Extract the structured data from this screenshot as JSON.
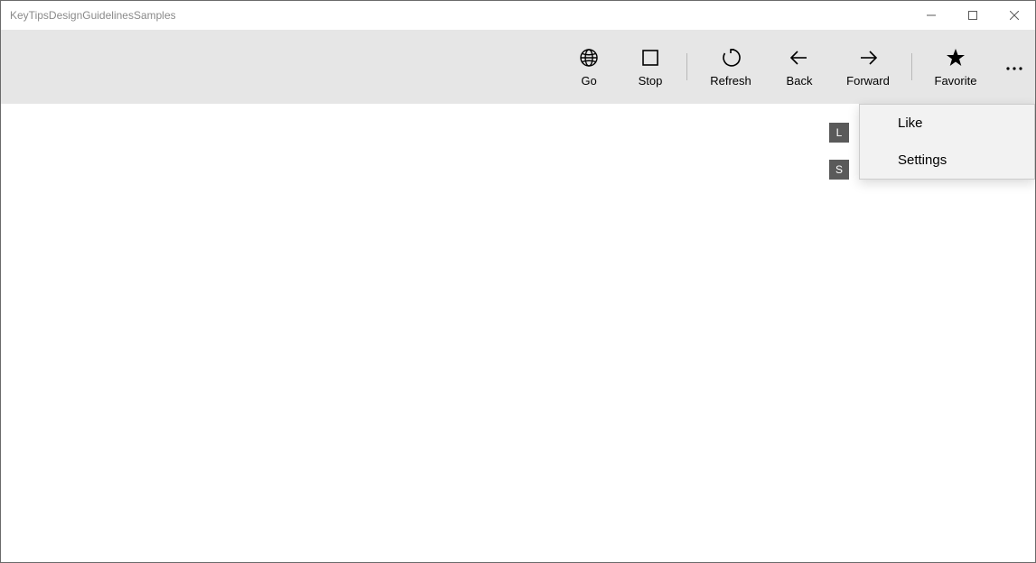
{
  "window": {
    "title": "KeyTipsDesignGuidelinesSamples"
  },
  "commandbar": {
    "go_label": "Go",
    "stop_label": "Stop",
    "refresh_label": "Refresh",
    "back_label": "Back",
    "forward_label": "Forward",
    "favorite_label": "Favorite"
  },
  "overflow": {
    "like_label": "Like",
    "settings_label": "Settings"
  },
  "keytips": {
    "like": "L",
    "settings": "S"
  }
}
